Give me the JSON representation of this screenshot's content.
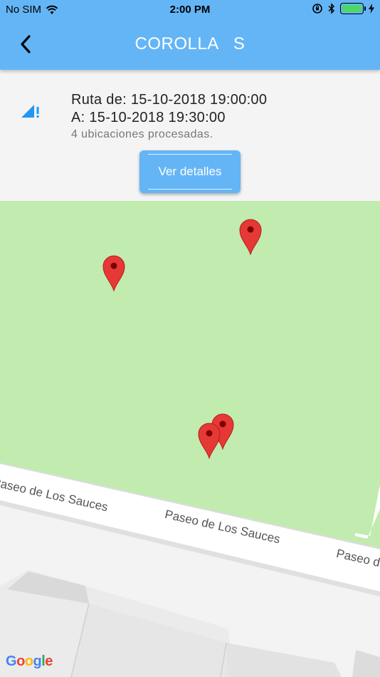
{
  "status_bar": {
    "carrier": "No SIM",
    "time": "2:00 PM"
  },
  "nav": {
    "title": "COROLLA   S",
    "back_icon": "chevron-left-icon"
  },
  "route": {
    "from_line": "Ruta de: 15-10-2018 19:00:00",
    "to_line": "A: 15-10-2018 19:30:00",
    "count_line": "4 ubicaciones procesadas.",
    "icon": "signal-alert-icon"
  },
  "details_button": {
    "label": "Ver detalles"
  },
  "map": {
    "street_labels": [
      "Paseo de Los Sauces",
      "Paseo de Los Sauces",
      "Paseo de"
    ],
    "attribution": [
      "G",
      "o",
      "o",
      "g",
      "l",
      "e"
    ],
    "marker_icon": "map-pin-icon"
  },
  "colors": {
    "header": "#64b5f6",
    "park": "#c2ebb0",
    "marker": "#e53935"
  }
}
